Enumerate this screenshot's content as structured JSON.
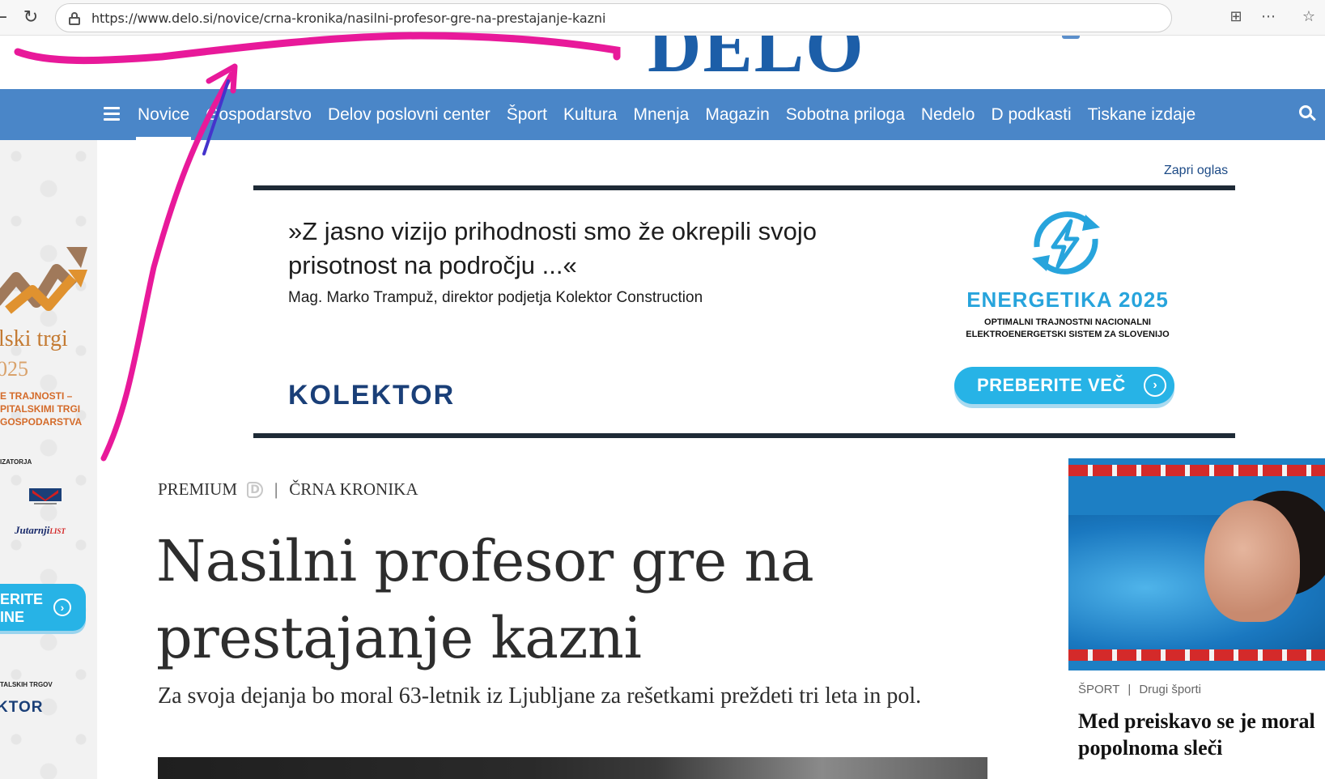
{
  "browser": {
    "url": "https://www.delo.si/novice/crna-kronika/nasilni-profesor-gre-na-prestajanje-kazni"
  },
  "site": {
    "logo": "DELO",
    "brand_color": "#1c5ea8"
  },
  "nav": {
    "items": [
      "Novice",
      "Gospodarstvo",
      "Delov poslovni center",
      "Šport",
      "Kultura",
      "Mnenja",
      "Magazin",
      "Sobotna priloga",
      "Nedelo",
      "D podkasti",
      "Tiskane izdaje"
    ],
    "active": "Novice",
    "bg_color": "#4a86c8"
  },
  "side_ad": {
    "title": "lski trgi",
    "year": "025",
    "subtitle_lines": [
      "E TRAJNOSTI –",
      "PITALSKIMI TRGI",
      "GOSPODARSTVA"
    ],
    "organizers_label": "IZATORJA",
    "partner_logo": "Jutarnji",
    "partner_logo_suffix": "LIST",
    "button_lines": [
      "ERITE",
      "INE"
    ],
    "partner_label": "TALSKIH TRGOV",
    "brand": "KTOR"
  },
  "banner_ad": {
    "close_label": "Zapri oglas",
    "quote": "»Z jasno vizijo prihodnosti smo že okrepili svojo prisotnost na področju ...«",
    "author": "Mag. Marko Trampuž, direktor podjetja Kolektor Construction",
    "brand": "KOLEKTOR",
    "event_title": "ENERGETIKA 2025",
    "event_sub_1": "OPTIMALNI TRAJNOSTNI NACIONALNI",
    "event_sub_2": "ELEKTROENERGETSKI SISTEM ZA SLOVENIJO",
    "cta": "PREBERITE VEČ"
  },
  "article": {
    "premium_label": "PREMIUM",
    "separator": "|",
    "section": "ČRNA KRONIKA",
    "headline": "Nasilni profesor gre na prestajanje kazni",
    "lead": "Za svoja dejanja bo moral 63-letnik iz Ljubljane za rešetkami prežde­ti tri leta in pol."
  },
  "related": {
    "section": "ŠPORT",
    "separator": "|",
    "subsection": "Drugi športi",
    "title_line_1": "Med preiskavo se je moral",
    "title_line_2": "popolnoma sleči"
  }
}
